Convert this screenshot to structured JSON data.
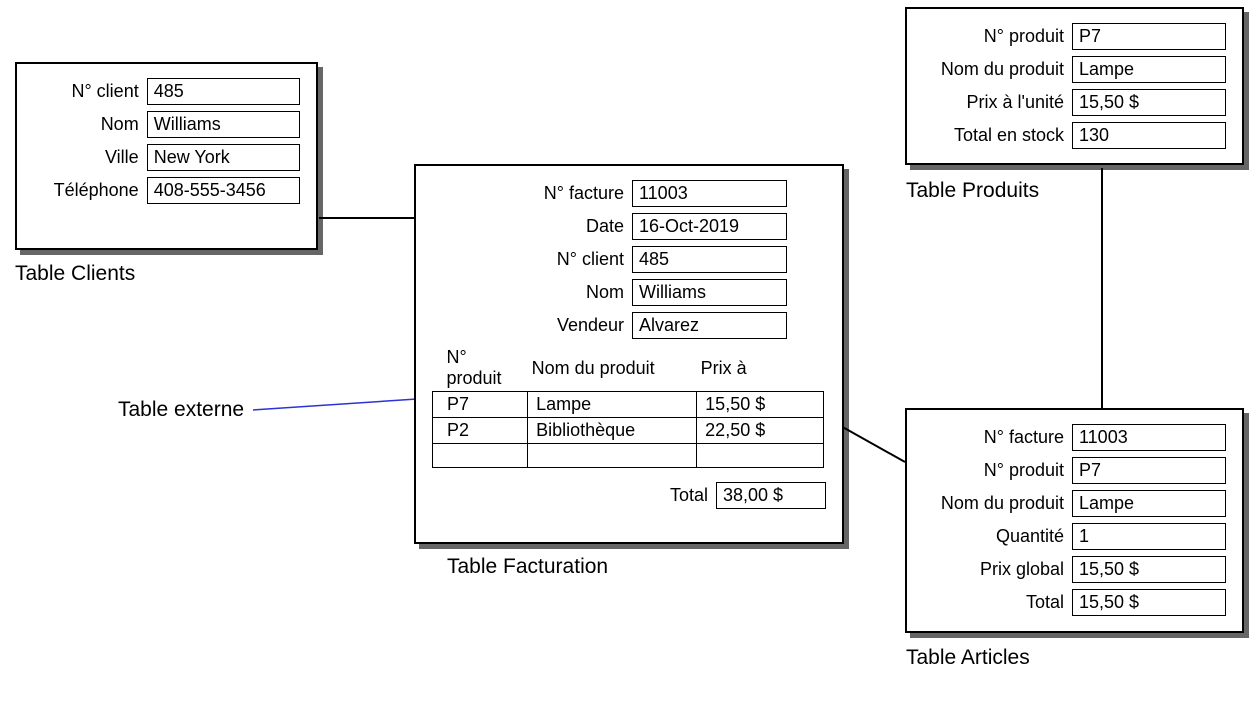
{
  "clients": {
    "title": "Table Clients",
    "fields": {
      "num_label": "N° client",
      "num_value": "485",
      "nom_label": "Nom",
      "nom_value": "Williams",
      "ville_label": "Ville",
      "ville_value": "New York",
      "tel_label": "Téléphone",
      "tel_value": "408-555-3456"
    }
  },
  "facturation": {
    "title": "Table Facturation",
    "fields": {
      "facture_label": "N° facture",
      "facture_value": "11003",
      "date_label": "Date",
      "date_value": "16-Oct-2019",
      "numclient_label": "N° client",
      "numclient_value": "485",
      "nom_label": "Nom",
      "nom_value": "Williams",
      "vendeur_label": "Vendeur",
      "vendeur_value": "Alvarez"
    },
    "columns": {
      "id": "N° produit",
      "name": "Nom du produit",
      "price": "Prix à"
    },
    "rows": [
      {
        "id": "P7",
        "name": "Lampe",
        "price": "15,50 $"
      },
      {
        "id": "P2",
        "name": "Bibliothèque",
        "price": "22,50 $"
      },
      {
        "id": "",
        "name": "",
        "price": ""
      }
    ],
    "total_label": "Total",
    "total_value": "38,00 $"
  },
  "produits": {
    "title": "Table Produits",
    "fields": {
      "num_label": "N° produit",
      "num_value": "P7",
      "nom_label": "Nom du produit",
      "nom_value": "Lampe",
      "prix_label": "Prix à l'unité",
      "prix_value": "15,50 $",
      "stock_label": "Total en stock",
      "stock_value": "130"
    }
  },
  "articles": {
    "title": "Table Articles",
    "fields": {
      "facture_label": "N° facture",
      "facture_value": "11003",
      "num_label": "N° produit",
      "num_value": "P7",
      "nom_label": "Nom du produit",
      "nom_value": "Lampe",
      "qte_label": "Quantité",
      "qte_value": "1",
      "prix_label": "Prix global",
      "prix_value": "15,50 $",
      "total_label": "Total",
      "total_value": "15,50 $"
    }
  },
  "annotations": {
    "table_externe": "Table externe"
  }
}
